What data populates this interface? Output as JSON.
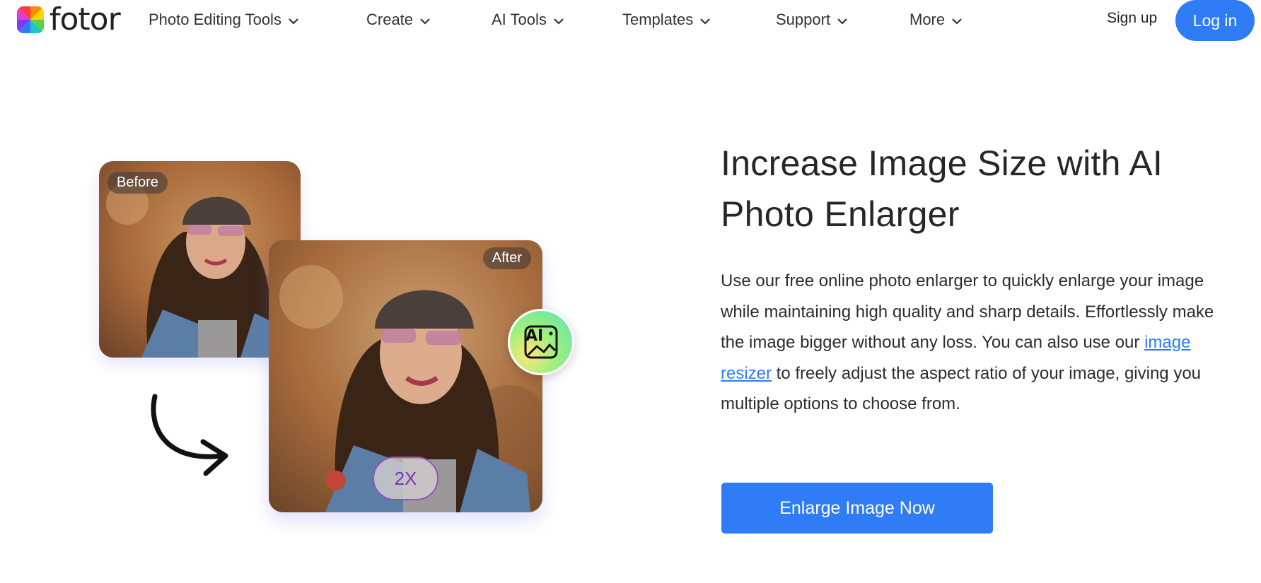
{
  "header": {
    "logo_text": "fotor",
    "nav": [
      {
        "label": "Photo Editing Tools"
      },
      {
        "label": "Create"
      },
      {
        "label": "AI Tools"
      },
      {
        "label": "Templates"
      },
      {
        "label": "Support"
      },
      {
        "label": "More"
      }
    ],
    "signup_label": "Sign up",
    "login_label": "Log in"
  },
  "illustration": {
    "before_label": "Before",
    "after_label": "After",
    "zoom_label": "2X",
    "ai_icon": "ai-image-icon",
    "arrow_icon": "curved-arrow-icon"
  },
  "hero": {
    "title": "Increase Image Size with AI Photo Enlarger",
    "desc_part1": "Use our free online photo enlarger to quickly enlarge your image while maintaining high quality and sharp details. Effortlessly make the image bigger without any loss. You can also use our ",
    "desc_link": "image resizer",
    "desc_part2": " to freely adjust the aspect ratio of your image, giving you multiple options to choose from.",
    "cta_label": "Enlarge Image Now"
  },
  "colors": {
    "accent": "#2f7cf6",
    "text": "#26262b",
    "zoom_badge": "#7a33b8"
  }
}
